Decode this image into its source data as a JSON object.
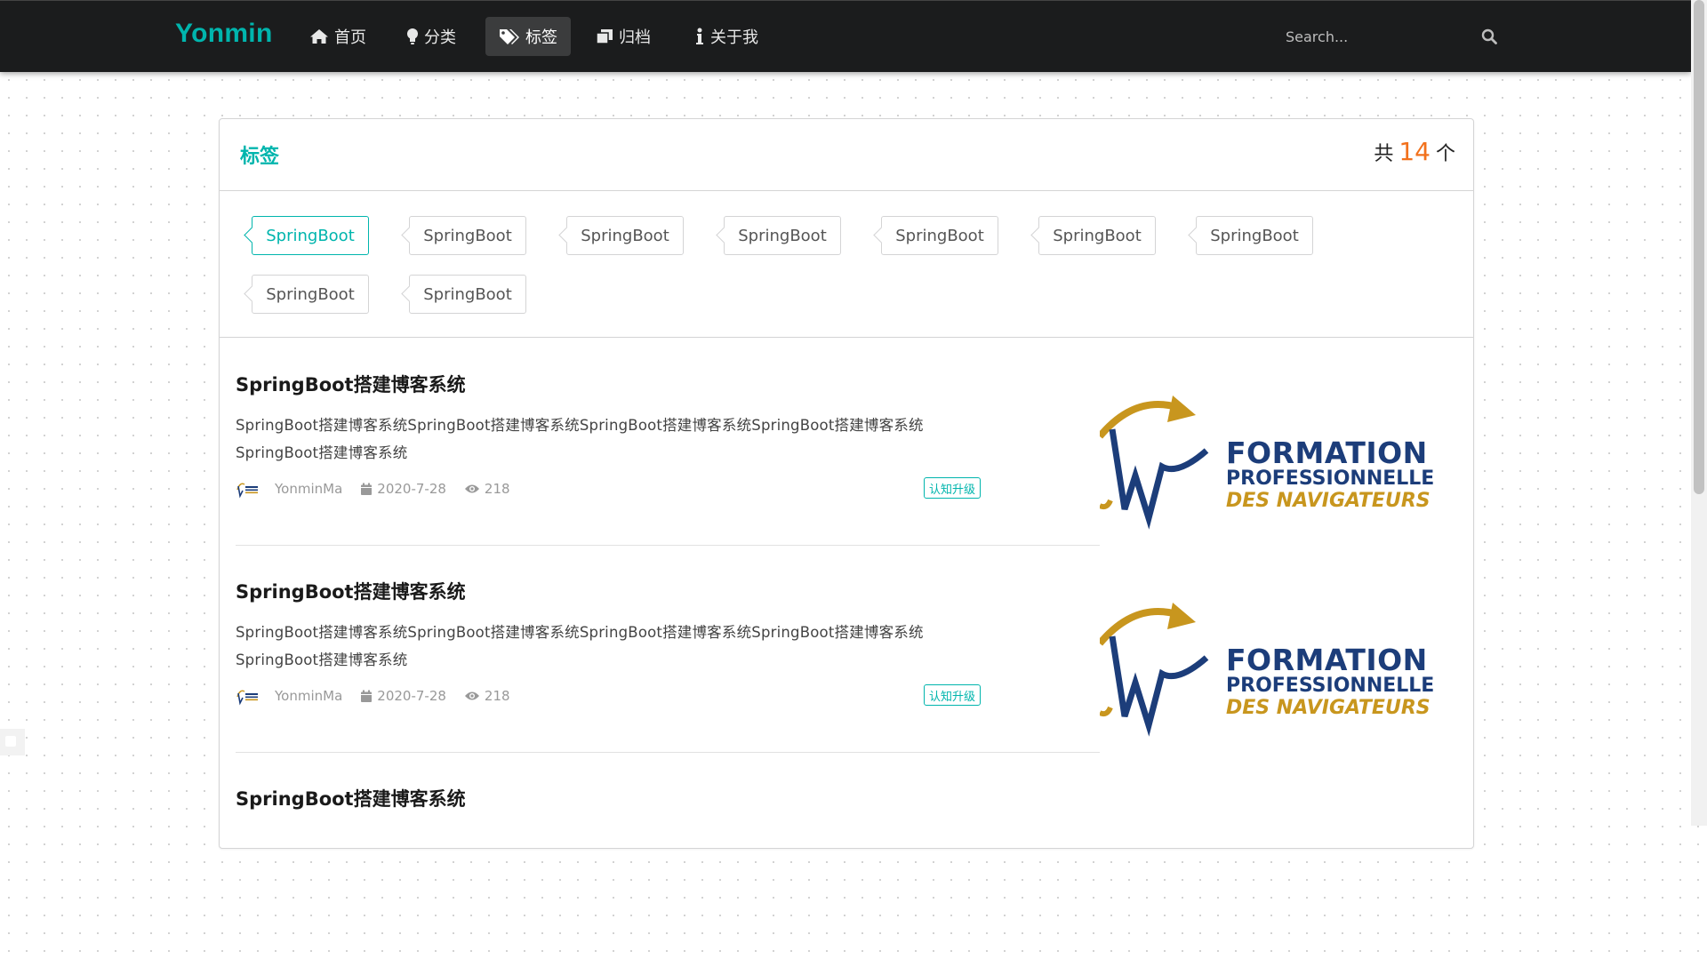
{
  "navbar": {
    "brand": "Yonmin",
    "items": [
      {
        "label": "首页",
        "icon": "home-icon"
      },
      {
        "label": "分类",
        "icon": "lightbulb-icon"
      },
      {
        "label": "标签",
        "icon": "tags-icon",
        "active": true
      },
      {
        "label": "归档",
        "icon": "archive-icon"
      },
      {
        "label": "关于我",
        "icon": "info-icon"
      }
    ],
    "search_placeholder": "Search...",
    "search_icon": "search-icon"
  },
  "tags_panel": {
    "title": "标签",
    "count_prefix": "共",
    "count": "14",
    "count_suffix": "个",
    "tags": [
      {
        "label": "SpringBoot",
        "active": true
      },
      {
        "label": "SpringBoot"
      },
      {
        "label": "SpringBoot"
      },
      {
        "label": "SpringBoot"
      },
      {
        "label": "SpringBoot"
      },
      {
        "label": "SpringBoot"
      },
      {
        "label": "SpringBoot"
      },
      {
        "label": "SpringBoot"
      },
      {
        "label": "SpringBoot"
      }
    ]
  },
  "posts": [
    {
      "title": "SpringBoot搭建博客系统",
      "description": "SpringBoot搭建博客系统SpringBoot搭建博客系统SpringBoot搭建博客系统SpringBoot搭建博客系统SpringBoot搭建博客系统",
      "author": "YonminMa",
      "date": "2020-7-28",
      "views": "218",
      "category": "认知升级",
      "thumb_lines": [
        "FORMATION",
        "PROFESSIONNELLE",
        "DES NAVIGATEURS"
      ]
    },
    {
      "title": "SpringBoot搭建博客系统",
      "description": "SpringBoot搭建博客系统SpringBoot搭建博客系统SpringBoot搭建博客系统SpringBoot搭建博客系统SpringBoot搭建博客系统",
      "author": "YonminMa",
      "date": "2020-7-28",
      "views": "218",
      "category": "认知升级",
      "thumb_lines": [
        "FORMATION",
        "PROFESSIONNELLE",
        "DES NAVIGATEURS"
      ]
    },
    {
      "title": "SpringBoot搭建博客系统"
    }
  ],
  "colors": {
    "accent": "#00b5ad",
    "count": "#f2711c",
    "navbar": "#1b1c1d",
    "logo_blue": "#1c3d7a",
    "logo_gold": "#c8961e"
  }
}
